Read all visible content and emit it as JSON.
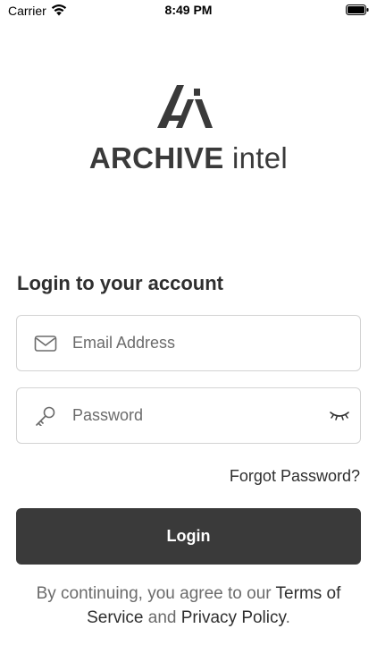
{
  "status_bar": {
    "carrier": "Carrier",
    "time": "8:49 PM"
  },
  "brand": {
    "name_main": "ARCHIVE",
    "name_suffix": "intel",
    "logo_icon": "archive-intel-logo-icon"
  },
  "login": {
    "heading": "Login to your account",
    "email_placeholder": "Email Address",
    "email_value": "",
    "email_icon": "envelope-icon",
    "password_placeholder": "Password",
    "password_value": "",
    "password_icon": "key-icon",
    "toggle_icon": "eye-closed-icon",
    "forgot_label": "Forgot Password?",
    "submit_label": "Login"
  },
  "footer": {
    "prefix": "By continuing, you agree to our",
    "terms_link": "Terms of Service",
    "conjunction": "and",
    "privacy_link": "Privacy Policy",
    "suffix": "."
  },
  "colors": {
    "primary_button": "#3a3a3a",
    "text_dark": "#2f2f2f",
    "text_muted": "#6b6b6b",
    "border": "#d3d3d3"
  }
}
